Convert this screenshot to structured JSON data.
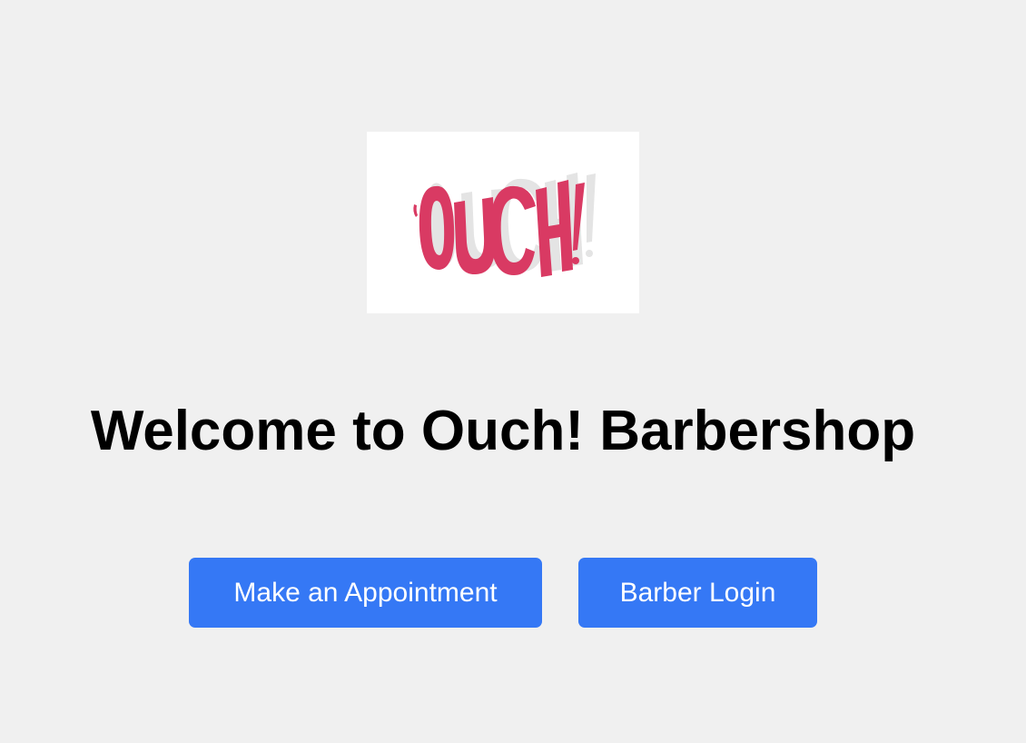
{
  "logo": {
    "text": "OUCH!",
    "colors": {
      "letters": "#d93a63",
      "shadow": "#e4e4e4",
      "background": "#ffffff"
    }
  },
  "heading": "Welcome to Ouch! Barbershop",
  "buttons": {
    "appointment_label": "Make an Appointment",
    "login_label": "Barber Login"
  },
  "colors": {
    "page_background": "#f0f0f0",
    "button_background": "#3578f5",
    "button_text": "#ffffff",
    "heading_text": "#000000"
  }
}
